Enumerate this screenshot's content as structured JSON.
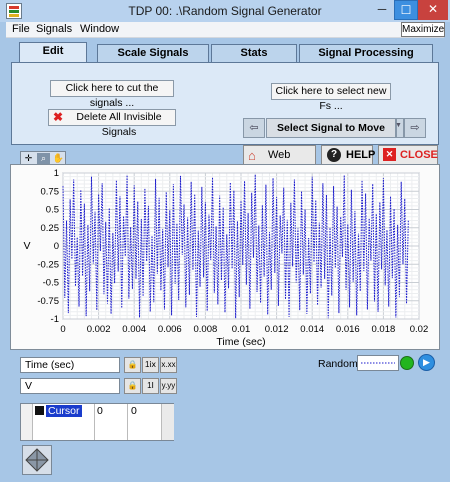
{
  "window": {
    "title": "TDP 00: .\\Random Signal Generator",
    "minimize_glyph": "─",
    "maximize_glyph": "☐",
    "close_glyph": "✕",
    "maximize_tooltip": "Maximize"
  },
  "menu": [
    "File",
    "Signals",
    "Window"
  ],
  "tabs": [
    {
      "label": "Edit",
      "active": true
    },
    {
      "label": "Scale Signals",
      "active": false
    },
    {
      "label": "Stats",
      "active": false
    },
    {
      "label": "Signal Processing",
      "active": false
    }
  ],
  "edit_panel": {
    "cut_signals_label": "Click here to cut the signals ...",
    "select_fs_label": "Click here to select new Fs ...",
    "delete_invisible_label": "Delete All Invisible Signals",
    "select_signal_label": "Select Signal to Move ...",
    "prev_glyph": "⇦",
    "next_glyph": "⇨"
  },
  "controls": {
    "web_home_label": "Web Home",
    "help_label": "HELP",
    "close_label": "CLOSE"
  },
  "chart_data": {
    "type": "line",
    "xlabel": "Time (sec)",
    "ylabel": "V",
    "xlim": [
      0,
      0.02
    ],
    "ylim": [
      -1,
      1
    ],
    "x_ticks": [
      "0",
      "0.002",
      "0.004",
      "0.006",
      "0.008",
      "0.01",
      "0.012",
      "0.014",
      "0.016",
      "0.018",
      "0.02"
    ],
    "y_ticks": [
      "1",
      "0.75",
      "0.5",
      "0.25",
      "0",
      "-0.25",
      "-0.5",
      "-0.75",
      "-1"
    ],
    "grid": true,
    "series": [
      {
        "name": "Random",
        "color": "#1a1acc",
        "line_style": "dotted",
        "x_start": 0,
        "dx": 0.0001,
        "values": [
          0.82,
          -0.71,
          0.35,
          -0.92,
          0.64,
          -0.18,
          0.91,
          -0.55,
          0.12,
          -0.83,
          0.77,
          -0.41,
          0.58,
          -0.96,
          0.29,
          -0.62,
          0.95,
          -0.24,
          0.47,
          -0.88,
          0.71,
          -0.07,
          0.86,
          -0.66,
          0.33,
          -0.79,
          0.52,
          -0.93,
          0.18,
          -0.51,
          0.9,
          -0.35,
          0.68,
          -0.85,
          0.41,
          -0.14,
          0.97,
          -0.72,
          0.26,
          -0.59,
          0.83,
          -0.45,
          0.61,
          -0.98,
          0.37,
          -0.69,
          0.79,
          -0.21,
          0.55,
          -0.9,
          0.14,
          -0.77,
          0.92,
          -0.38,
          0.66,
          -0.61,
          0.23,
          -0.87,
          0.74,
          -0.29,
          0.49,
          -0.95,
          0.85,
          -0.52,
          0.31,
          -0.74,
          0.96,
          -0.12,
          0.57,
          -0.84,
          0.39,
          -0.67,
          0.88,
          -0.33,
          0.71,
          -0.97,
          0.21,
          -0.56,
          0.81,
          -0.43,
          0.6,
          -0.89,
          0.43,
          -0.19,
          0.94,
          -0.64,
          0.27,
          -0.8,
          0.69,
          -0.47,
          0.53,
          -0.91,
          0.16,
          -0.58,
          0.87,
          -0.31,
          0.76,
          -0.99,
          0.34,
          -0.7,
          0.62,
          -0.26,
          0.89,
          -0.53,
          0.45,
          -0.86,
          0.73,
          -0.16,
          0.98,
          -0.63,
          0.28,
          -0.78,
          0.56,
          -0.42,
          0.84,
          -0.94,
          0.19,
          -0.6,
          0.93,
          -0.37,
          0.67,
          -0.82,
          0.42,
          -0.1,
          0.8,
          -0.73,
          0.36,
          -0.97,
          0.59,
          -0.28,
          0.91,
          -0.5,
          0.24,
          -0.88,
          0.75,
          -0.39,
          0.5,
          -0.93,
          0.11,
          -0.65,
          0.95,
          -0.22,
          0.63,
          -0.81,
          0.32,
          -0.57,
          0.86,
          -0.45,
          0.7,
          -0.99,
          0.25,
          -0.68,
          0.82,
          -0.3,
          0.54,
          -0.92,
          0.4,
          -0.15,
          0.97,
          -0.6,
          0.3,
          -0.84,
          0.77,
          -0.49,
          0.48,
          -0.95,
          0.17,
          -0.62,
          0.9,
          -0.34,
          0.72,
          -0.87,
          0.38,
          -0.2,
          0.85,
          -0.76,
          0.44,
          -0.9,
          0.6,
          -0.32,
          0.93,
          -0.54,
          0.22,
          -0.83,
          0.68,
          -0.44,
          0.51,
          -0.98,
          0.29,
          -0.7,
          0.88,
          -0.25,
          0.65,
          -0.79,
          0.35
        ]
      }
    ]
  },
  "axis_controls": {
    "x_axis_name": "Time (sec)",
    "y_axis_name": "V",
    "lock_glyph": "🔒",
    "x_format_glyph": "x.xx",
    "x_scale_glyph": "1ⅸ",
    "y_format_glyph": "y.yy",
    "y_scale_glyph": "1Ⅰ"
  },
  "legend": {
    "label": "Random"
  },
  "cursor_table": {
    "rows": [
      {
        "name": "Cursor",
        "x": "0",
        "y": "0"
      }
    ]
  },
  "status_indicator_color": "#22b51e"
}
